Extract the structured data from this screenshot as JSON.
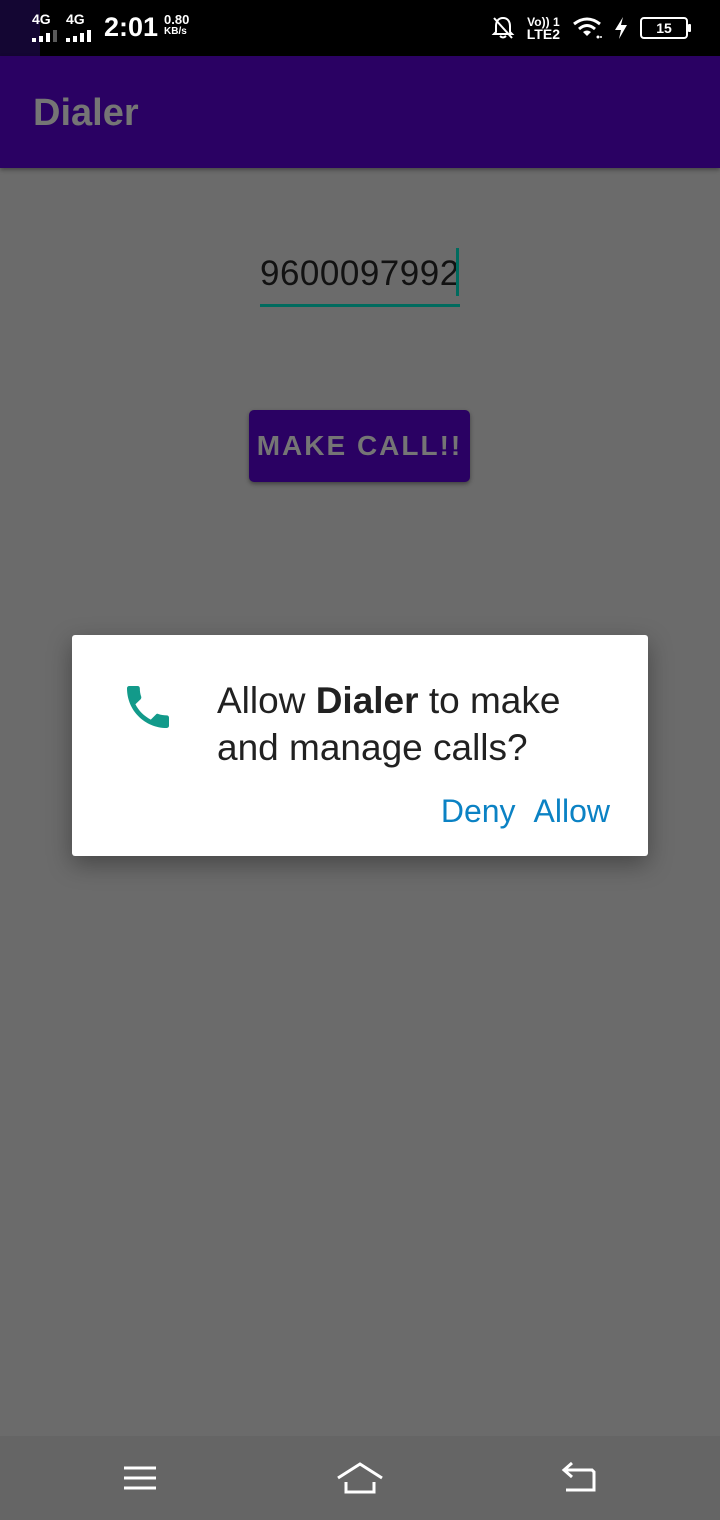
{
  "status_bar": {
    "sim1_network": "4G",
    "sim2_network": "4G",
    "time": "2:01",
    "speed_value": "0.80",
    "speed_unit": "KB/s",
    "volte_top": "Vo)) 1",
    "volte_bottom": "LTE2",
    "battery": "15",
    "icons": [
      "notification-off-icon",
      "wifi-icon",
      "charging-icon",
      "battery-icon"
    ]
  },
  "app_bar": {
    "title": "Dialer"
  },
  "main": {
    "phone_number": "9600097992",
    "call_button_label": "MAKE CALL!!"
  },
  "dialog": {
    "icon": "phone-icon",
    "message_prefix": "Allow ",
    "app_name": "Dialer",
    "message_suffix": " to make and manage calls?",
    "deny_label": "Deny",
    "allow_label": "Allow"
  },
  "nav_bar": {
    "icons": [
      "menu-icon",
      "home-icon",
      "back-icon"
    ]
  },
  "colors": {
    "primary": "#2a0163",
    "accent": "#006b5e",
    "dialog_action": "#0b82c4",
    "scrim": "#6b6b6b"
  }
}
